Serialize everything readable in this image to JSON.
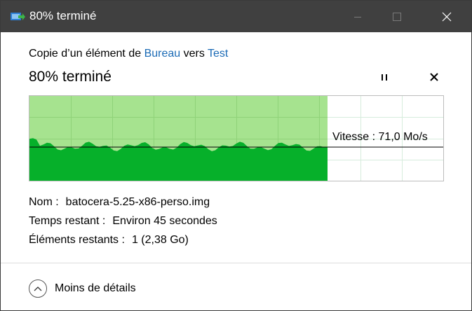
{
  "window": {
    "title": "80% terminé",
    "colors": {
      "titlebar": "#404040",
      "accent_link": "#1a6ab5",
      "progress_light": "#a6e38f",
      "progress_dark": "#06b02a"
    }
  },
  "header": {
    "copy_prefix": "Copie d’un élément de",
    "source": "Bureau",
    "connector": "vers",
    "destination": "Test",
    "status": "80% terminé",
    "progress_percent": 80
  },
  "graph": {
    "speed_text": "Vitesse : 71,0 Mo/s"
  },
  "info": {
    "name_label": "Nom :",
    "name_value": "batocera-5.25-x86-perso.img",
    "time_label": "Temps restant :",
    "time_value": "Environ 45 secondes",
    "items_label": "Éléments restants :",
    "items_value": "1 (2,38 Go)"
  },
  "footer": {
    "details_label": "Moins de détails"
  },
  "icons": {
    "title": "copy-transfer-icon",
    "minimize": "minimize-icon",
    "maximize": "maximize-icon",
    "close": "close-icon",
    "pause": "pause-icon",
    "cancel": "cancel-icon",
    "details": "chevron-up-icon"
  }
}
